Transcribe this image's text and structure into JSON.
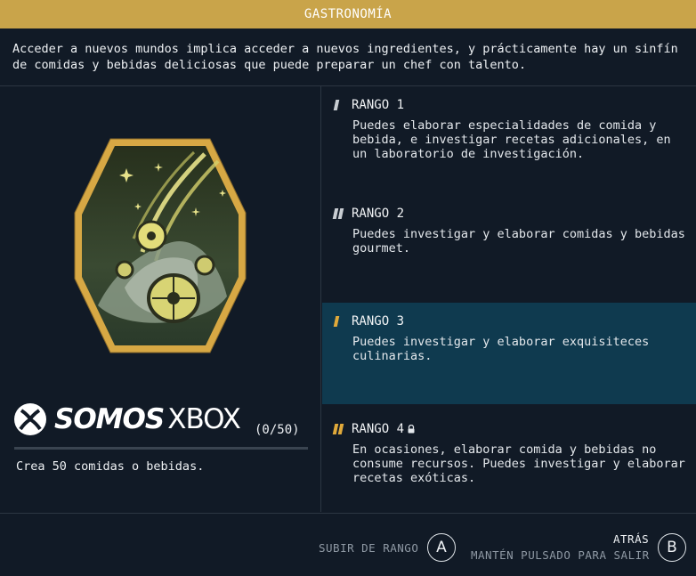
{
  "header": {
    "title": "GASTRONOMÍA"
  },
  "description": "Acceder a nuevos mundos implica acceder a nuevos ingredientes, y prácticamente hay un sinfín de comidas y bebidas deliciosas que puede preparar un chef con talento.",
  "skill": {
    "watermark_brand_bold": "SOMOS",
    "watermark_brand_light": "XBOX",
    "progress_text": "(0/50)",
    "progress_fraction": 0,
    "task": "Crea 50 comidas o bebidas."
  },
  "ranks": [
    {
      "label": "RANGO 1",
      "text": "Puedes elaborar especialidades de comida y bebida, e investigar recetas adicionales, en un laboratorio de investigación.",
      "markers": 1,
      "active": false,
      "locked": false
    },
    {
      "label": "RANGO 2",
      "text": "Puedes investigar y elaborar comidas y bebidas gourmet.",
      "markers": 2,
      "active": false,
      "locked": false
    },
    {
      "label": "RANGO 3",
      "text": "Puedes investigar y elaborar exquisiteces culinarias.",
      "markers": 1,
      "active": true,
      "locked": false
    },
    {
      "label": "RANGO 4",
      "text": "En ocasiones, elaborar comida y bebidas no consume recursos. Puedes investigar y elaborar recetas exóticas.",
      "markers": 2,
      "active": false,
      "locked": true
    }
  ],
  "footer": {
    "rank_up_label": "SUBIR DE RANGO",
    "rank_up_key": "A",
    "back_label": "ATRÁS",
    "back_hint": "MANTÉN PULSADO PARA SALIR",
    "back_key": "B"
  },
  "colors": {
    "accent": "#c9a44a",
    "background": "#111a26",
    "active_row": "#0f3a4f",
    "marker_default": "#c8cdd2"
  }
}
